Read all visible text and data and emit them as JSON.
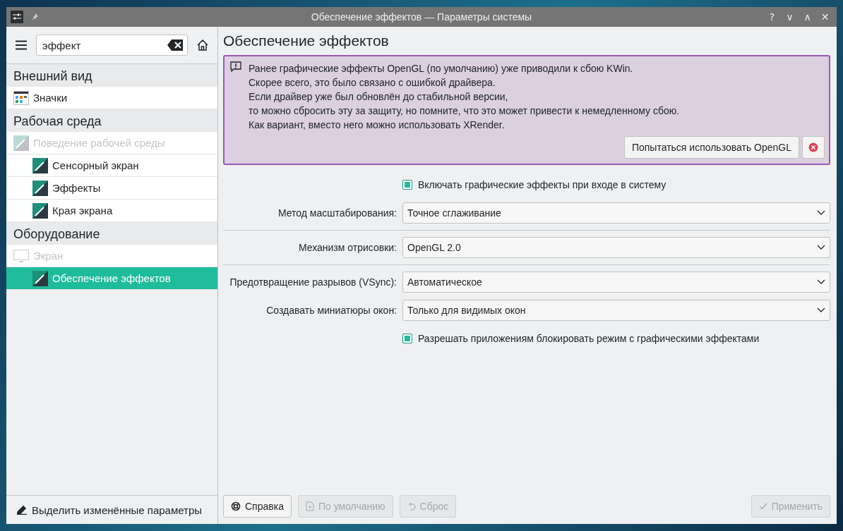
{
  "window": {
    "title": "Обеспечение эффектов — Параметры системы",
    "controls": [
      "?",
      "∨",
      "∧",
      "✕"
    ]
  },
  "search": {
    "value": "эффект"
  },
  "sidebar": {
    "sections": [
      {
        "title": "Внешний вид",
        "items": [
          {
            "label": "Значки",
            "disabled": false,
            "selected": false
          }
        ]
      },
      {
        "title": "Рабочая среда",
        "items": [
          {
            "label": "Поведение рабочей среды",
            "disabled": true,
            "selected": false,
            "children": [
              {
                "label": "Сенсорный экран",
                "selected": false
              },
              {
                "label": "Эффекты",
                "selected": false
              },
              {
                "label": "Края экрана",
                "selected": false
              }
            ]
          }
        ]
      },
      {
        "title": "Оборудование",
        "items": [
          {
            "label": "Экран",
            "disabled": true,
            "selected": false,
            "children": [
              {
                "label": "Обеспечение эффектов",
                "selected": true
              }
            ]
          }
        ]
      }
    ]
  },
  "highlight_button": "Выделить изменённые параметры",
  "page": {
    "title": "Обеспечение эффектов",
    "warning": {
      "lines": [
        "Ранее графические эффекты OpenGL (по умолчанию) уже приводили к сбою KWin.",
        "Скорее всего, это было связано с ошибкой драйвера.",
        "Если драйвер уже был обновлён до стабильной версии,",
        "то можно сбросить эту за защиту, но помните, что это может привести к немедленному сбою.",
        "Как вариант, вместо него можно использовать XRender."
      ],
      "action": "Попытаться использовать OpenGL"
    },
    "rows": [
      {
        "kind": "checkbox",
        "label": "Включать графические эффекты при входе в систему",
        "checked": true
      },
      {
        "kind": "select",
        "label": "Метод масштабирования:",
        "value": "Точное сглаживание"
      },
      {
        "kind": "separator"
      },
      {
        "kind": "select",
        "label": "Механизм отрисовки:",
        "value": "OpenGL 2.0"
      },
      {
        "kind": "separator"
      },
      {
        "kind": "select",
        "label": "Предотвращение разрывов (VSync):",
        "value": "Автоматическое"
      },
      {
        "kind": "select",
        "label": "Создавать миниатюры окон:",
        "value": "Только для видимых окон"
      },
      {
        "kind": "checkbox",
        "label": "Разрешать приложениям блокировать режим с графическими эффектами",
        "checked": true
      }
    ]
  },
  "footer": {
    "buttons": [
      {
        "label": "Справка",
        "disabled": false
      },
      {
        "label": "По умолчанию",
        "disabled": true
      },
      {
        "label": "Сброс",
        "disabled": true
      }
    ],
    "apply": {
      "label": "Применить",
      "disabled": true
    }
  }
}
